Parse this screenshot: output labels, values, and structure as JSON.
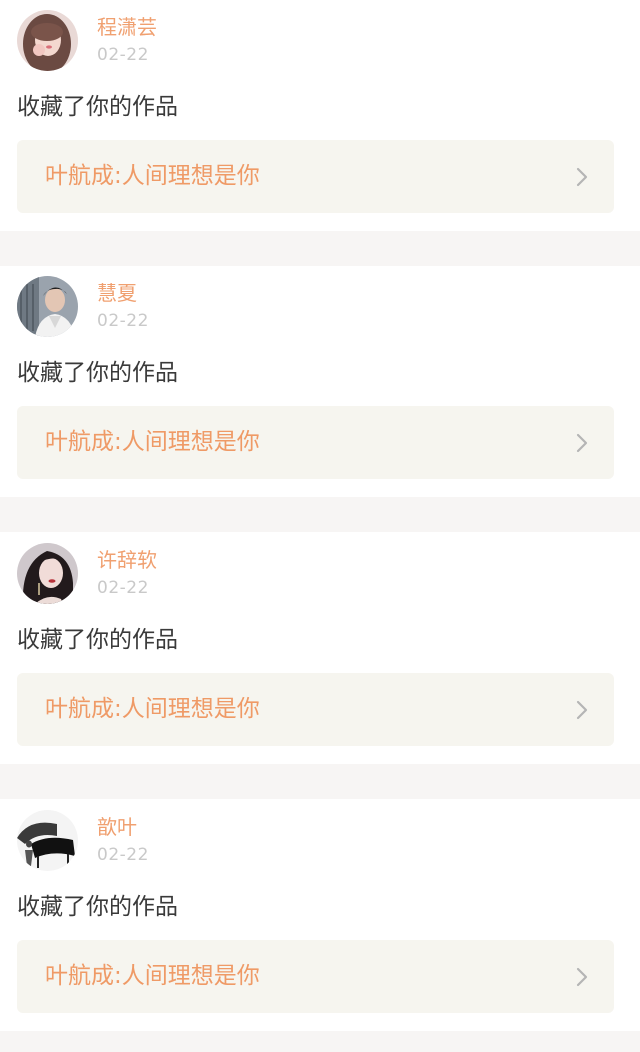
{
  "notifications": [
    {
      "username": "程潇芸",
      "date": "02-22",
      "action": "收藏了你的作品",
      "work_title": "叶航成:人间理想是你",
      "avatar_icon": "avatar-woman-pink"
    },
    {
      "username": "慧夏",
      "date": "02-22",
      "action": "收藏了你的作品",
      "work_title": "叶航成:人间理想是你",
      "avatar_icon": "avatar-man-building"
    },
    {
      "username": "许辞软",
      "date": "02-22",
      "action": "收藏了你的作品",
      "work_title": "叶航成:人间理想是你",
      "avatar_icon": "avatar-woman-dark-hair"
    },
    {
      "username": "歆叶",
      "date": "02-22",
      "action": "收藏了你的作品",
      "work_title": "叶航成:人间理想是你",
      "avatar_icon": "avatar-piano-bw"
    }
  ],
  "colors": {
    "username": "#f0a070",
    "date": "#c9c9c9",
    "action_text": "#3a3a3a",
    "work_title": "#ef9a66",
    "work_box_bg": "#f6f5ef",
    "separator_bg": "#f7f5f4",
    "chevron": "#b5b5b5"
  }
}
